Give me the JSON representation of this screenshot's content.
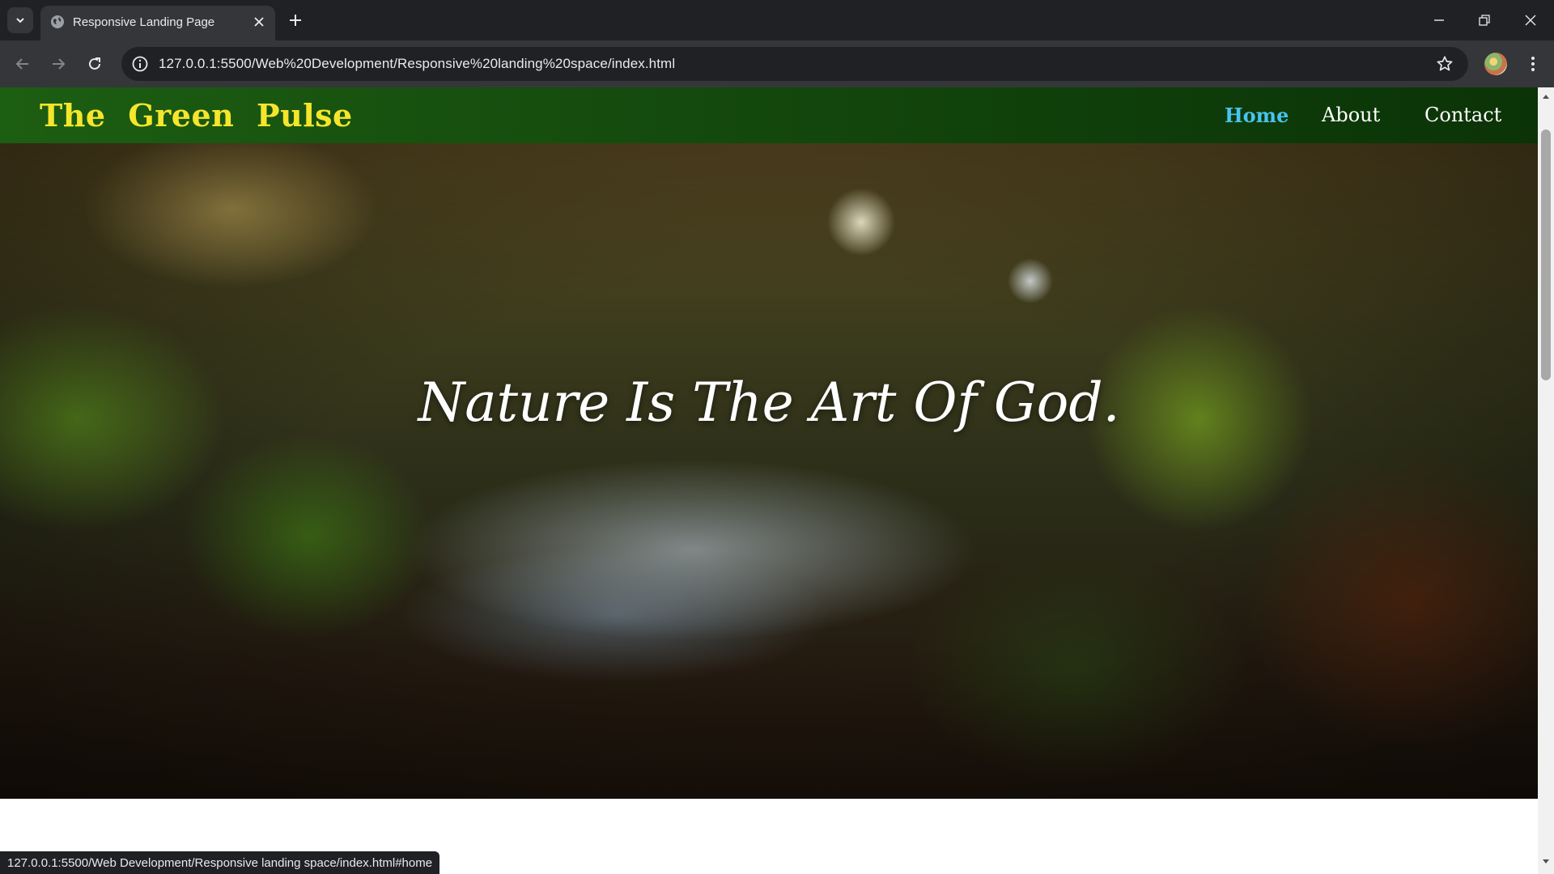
{
  "browser": {
    "tab_title": "Responsive Landing Page",
    "url": "127.0.0.1:5500/Web%20Development/Responsive%20landing%20space/index.html",
    "status_url": "127.0.0.1:5500/Web Development/Responsive landing space/index.html#home"
  },
  "site": {
    "logo": "The Green Pulse",
    "nav": {
      "home": "Home",
      "about": "About",
      "contact": "Contact"
    },
    "hero_text": "Nature Is The Art Of God."
  },
  "colors": {
    "logo": "#f5e62c",
    "nav_active": "#48c4f0",
    "nav_bg": "#17500f"
  }
}
